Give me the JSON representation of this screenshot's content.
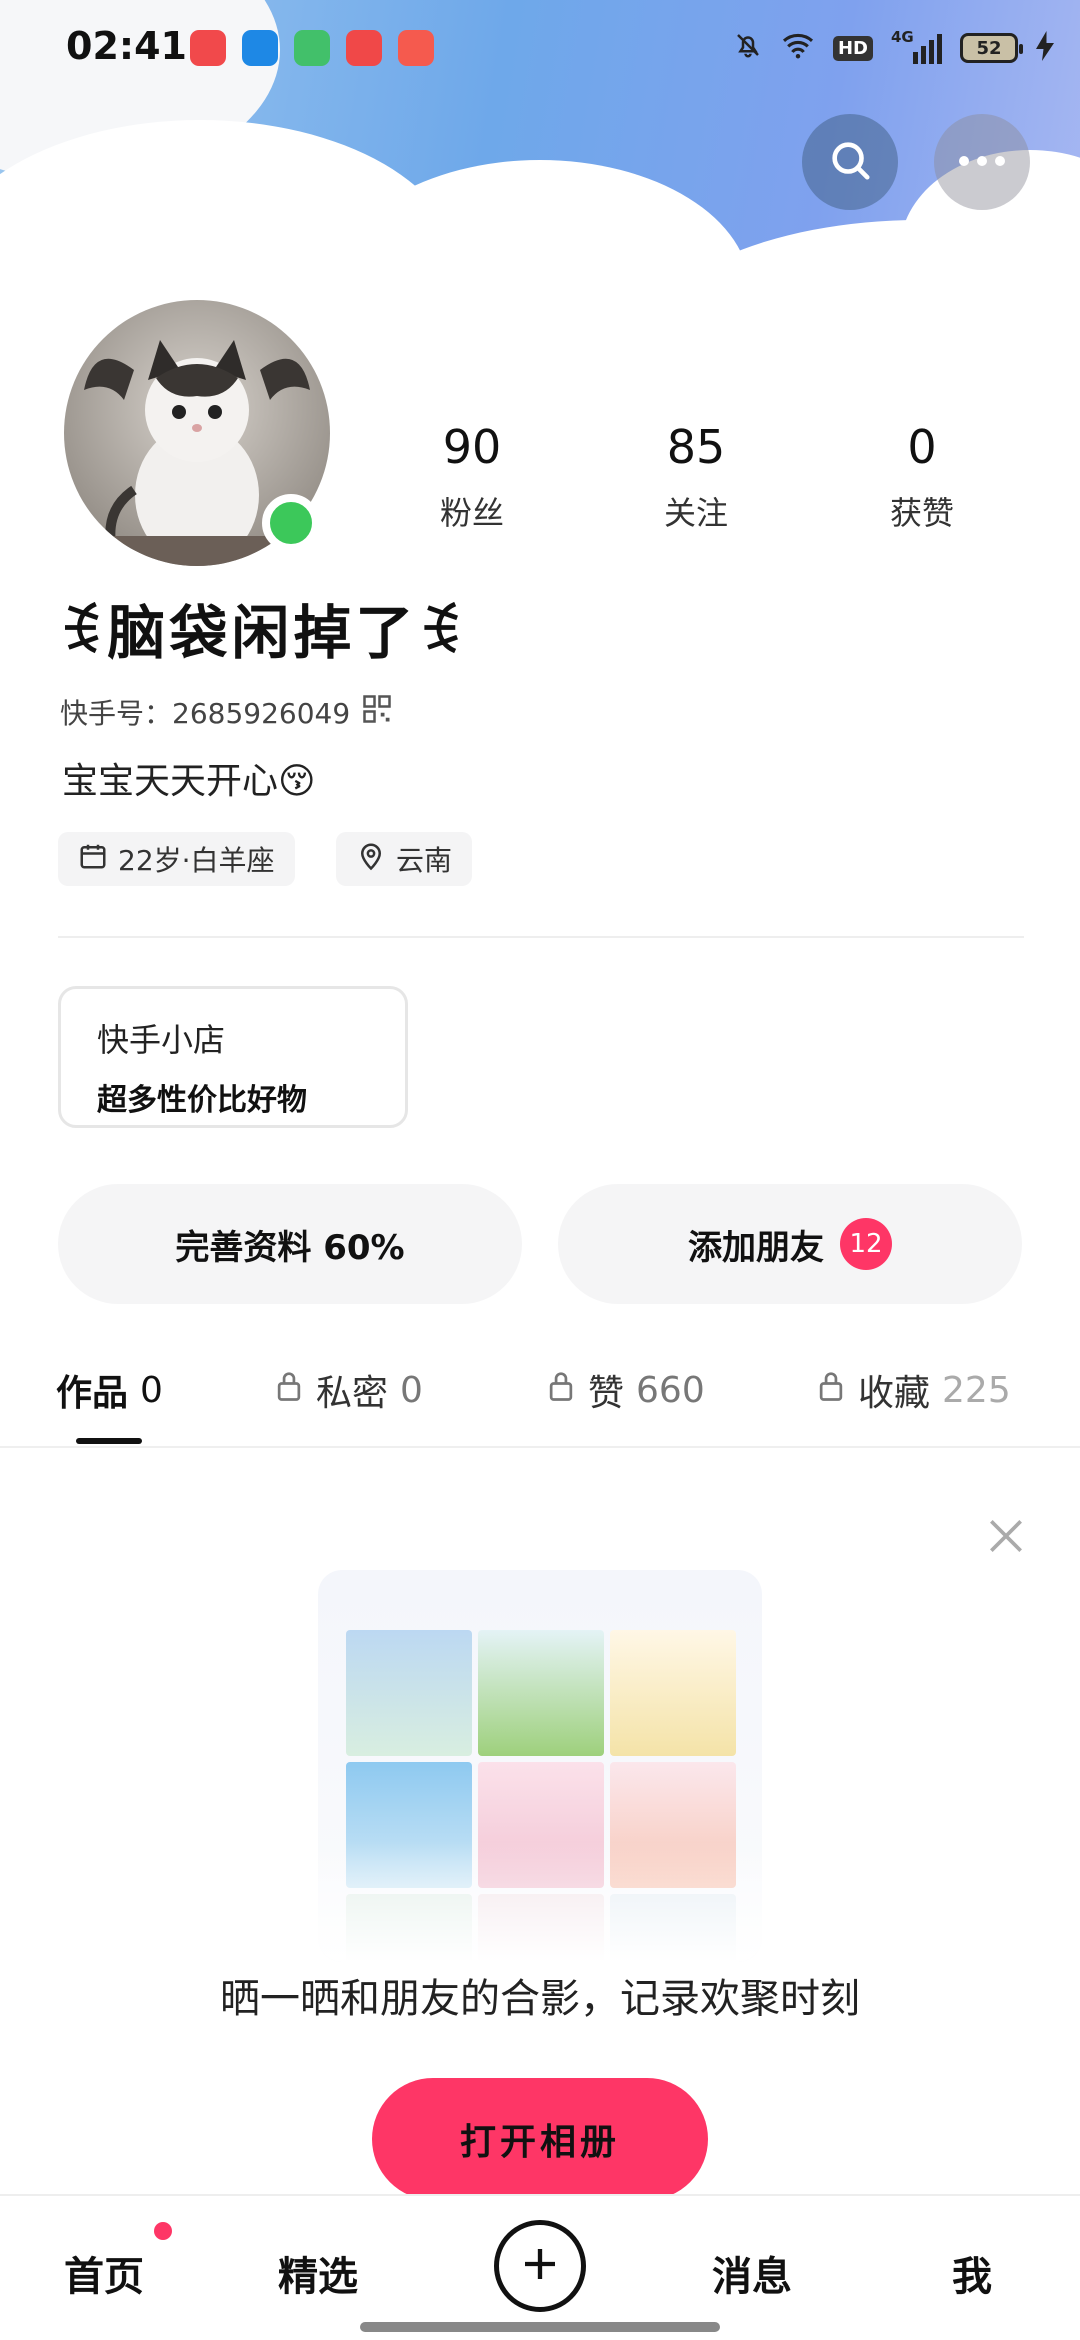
{
  "status_bar": {
    "time": "02:41",
    "hd": "HD",
    "network": "4G",
    "battery": "52"
  },
  "header": {
    "search_icon": "search-icon",
    "more_icon": "more-icon"
  },
  "profile": {
    "nickname": "ꉂ脑袋闲掉了ꉂ",
    "kwai_id": "快手号：2685926049",
    "bio": "宝宝天天开心😚",
    "stats": [
      {
        "value": "90",
        "label": "粉丝"
      },
      {
        "value": "85",
        "label": "关注"
      },
      {
        "value": "0",
        "label": "获赞"
      }
    ],
    "tags": [
      {
        "icon": "calendar-icon",
        "text": "22岁·白羊座"
      },
      {
        "icon": "location-icon",
        "text": "云南"
      }
    ]
  },
  "shop": {
    "title": "快手小店",
    "subtitle": "超多性价比好物"
  },
  "actions": {
    "complete_profile": "完善资料 60%",
    "add_friends": "添加朋友",
    "add_friends_badge": "12"
  },
  "tabs": [
    {
      "label": "作品",
      "count": "0",
      "locked": false
    },
    {
      "label": "私密",
      "count": "0",
      "locked": true
    },
    {
      "label": "赞",
      "count": "660",
      "locked": true
    },
    {
      "label": "收藏",
      "count": "225",
      "locked": true
    }
  ],
  "empty_state": {
    "prompt": "晒一晒和朋友的合影，记录欢聚时刻",
    "button": "打开相册"
  },
  "bottom_nav": {
    "home": "首页",
    "featured": "精选",
    "messages": "消息",
    "me": "我"
  },
  "colors": {
    "accent": "#fe3666",
    "online": "#3cc85a"
  }
}
